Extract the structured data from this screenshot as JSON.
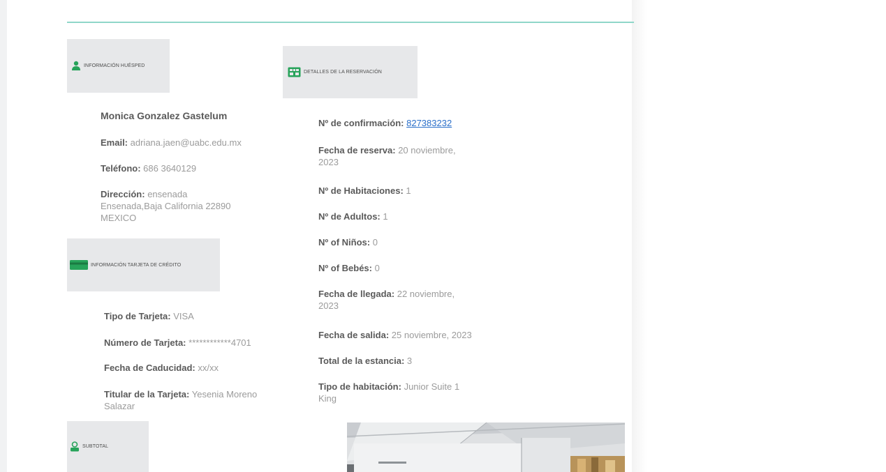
{
  "guest_section": {
    "title": "INFORMACIÓN HUÉSPED",
    "name": "Monica Gonzalez Gastelum",
    "email_label": "Email:",
    "email_value": "adriana.jaen@uabc.edu.mx",
    "phone_label": "Teléfono:",
    "phone_value": "686 3640129",
    "address_label": "Dirección:",
    "address_line1": "ensenada",
    "address_line2": "Ensenada,Baja California 22890",
    "address_line3": "MEXICO"
  },
  "card_section": {
    "title": "INFORMACIÓN TARJETA DE CRÉDITO",
    "type_label": "Tipo de Tarjeta:",
    "type_value": "VISA",
    "number_label": "Número de Tarjeta:",
    "number_value": "************4701",
    "expiry_label": "Fecha de Caducidad:",
    "expiry_value": "xx/xx",
    "holder_label": "Titular de la Tarjeta:",
    "holder_value_line1": "Yesenia Moreno",
    "holder_value_line2": "Salazar"
  },
  "subtotal_section": {
    "title": "SUBTOTAL"
  },
  "reservation_section": {
    "title": "DETALLES DE LA RESERVACIÓN",
    "confirmation_label": "Nº de confirmación:",
    "confirmation_value": "827383232",
    "booking_date_label": "Fecha de reserva:",
    "booking_date_line1": "20 noviembre,",
    "booking_date_line2": "2023",
    "rooms_label": "Nº de Habitaciones:",
    "rooms_value": "1",
    "adults_label": "Nº de Adultos:",
    "adults_value": "1",
    "children_label": "Nº of Niños:",
    "children_value": "0",
    "babies_label": "Nº of Bebés:",
    "babies_value": "0",
    "arrival_label": "Fecha de llegada:",
    "arrival_line1": "22 noviembre,",
    "arrival_line2": "2023",
    "departure_label": "Fecha de salida:",
    "departure_value": "25 noviembre, 2023",
    "stay_label": "Total de la estancia:",
    "stay_value": "3",
    "room_type_label": "Tipo de habitación:",
    "room_type_line1": "Junior Suite 1",
    "room_type_line2": "King"
  },
  "colors": {
    "accent": "#8fd6c9",
    "icon_green": "#27a35a",
    "link": "#2a6fc9",
    "header_bg": "#e7e8ea"
  },
  "icons": {
    "guest": "user-icon",
    "reservation": "hotel-icon",
    "card": "credit-card-icon",
    "subtotal": "user-icon"
  }
}
